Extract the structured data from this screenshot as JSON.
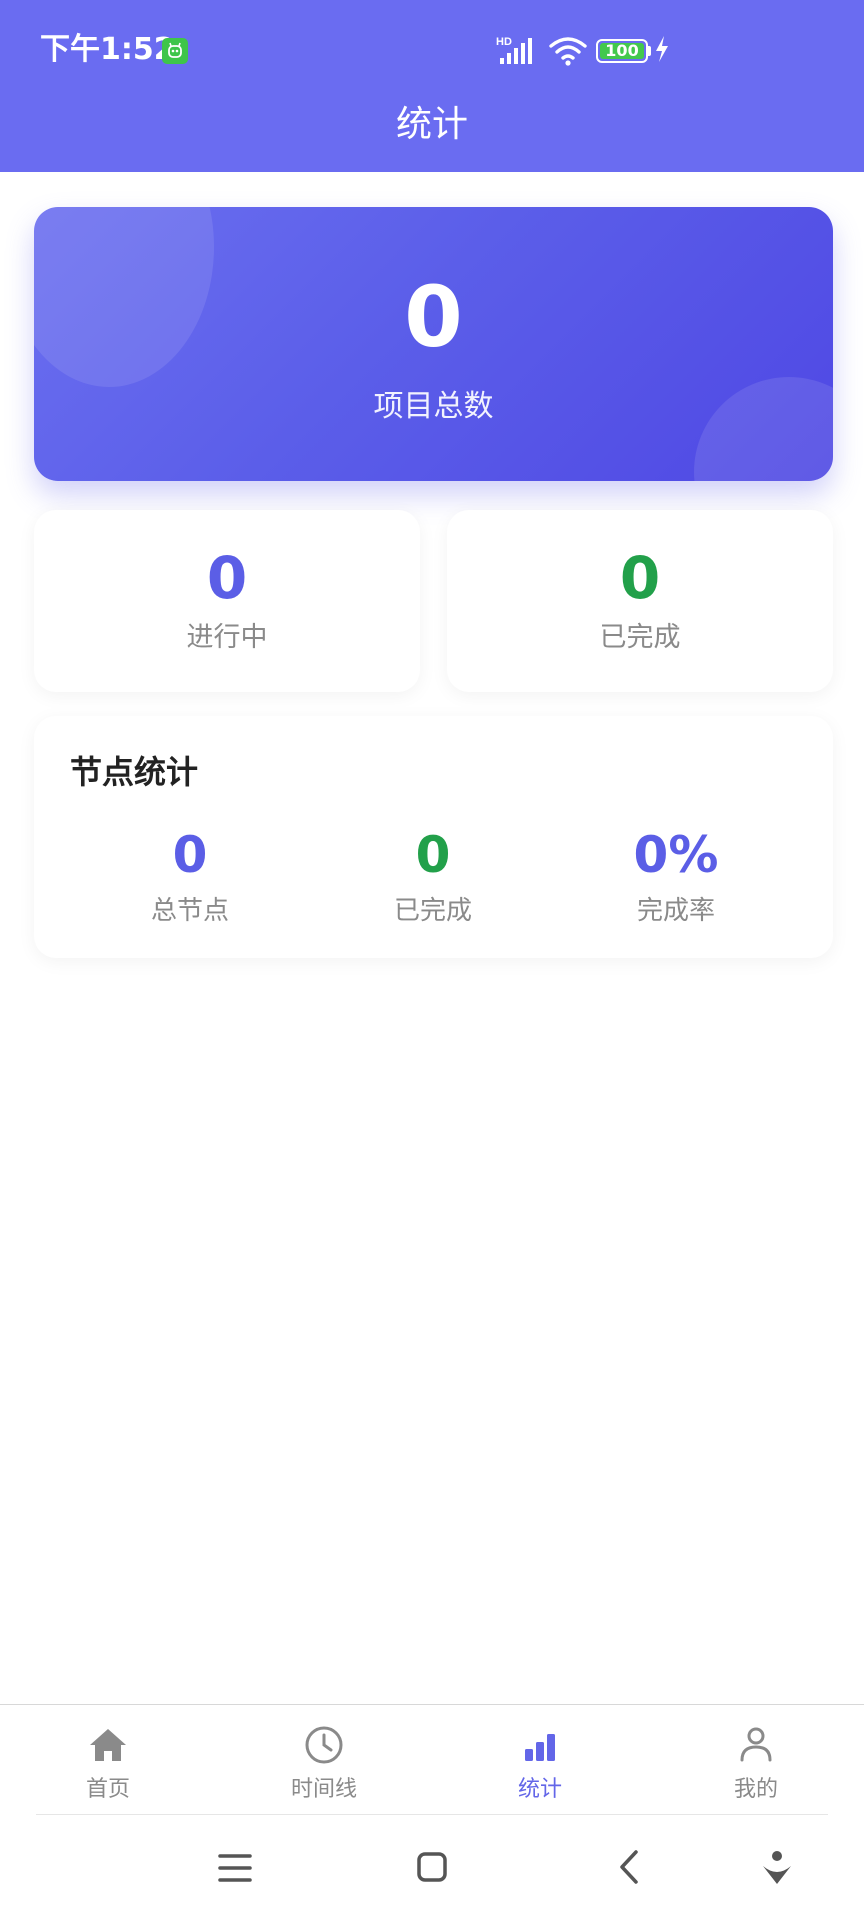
{
  "status_bar": {
    "time": "下午1:52",
    "network_label": "HD",
    "battery_level": "100",
    "charging": true,
    "icons": [
      "notification-app-icon",
      "signal-icon",
      "wifi-icon",
      "battery-icon",
      "charging-icon"
    ]
  },
  "header": {
    "title": "统计"
  },
  "summary": {
    "total_projects": {
      "value": "0",
      "label": "项目总数"
    },
    "in_progress": {
      "value": "0",
      "label": "进行中"
    },
    "completed": {
      "value": "0",
      "label": "已完成"
    }
  },
  "nodes": {
    "title": "节点统计",
    "total": {
      "value": "0",
      "label": "总节点"
    },
    "completed": {
      "value": "0",
      "label": "已完成"
    },
    "rate": {
      "value": "0%",
      "label": "完成率"
    }
  },
  "tabs": [
    {
      "label": "首页",
      "icon": "home-icon",
      "active": false
    },
    {
      "label": "时间线",
      "icon": "clock-icon",
      "active": false
    },
    {
      "label": "统计",
      "icon": "bar-chart-icon",
      "active": true
    },
    {
      "label": "我的",
      "icon": "person-icon",
      "active": false
    }
  ],
  "system_nav": [
    "menu-icon",
    "home-square-icon",
    "back-icon",
    "assistant-icon"
  ],
  "colors": {
    "primary": "#6a6cf1",
    "accent_blue": "#5b5ee6",
    "accent_green": "#22a04a",
    "text_muted": "#8a8a8a",
    "tab_active": "#6366e8"
  }
}
